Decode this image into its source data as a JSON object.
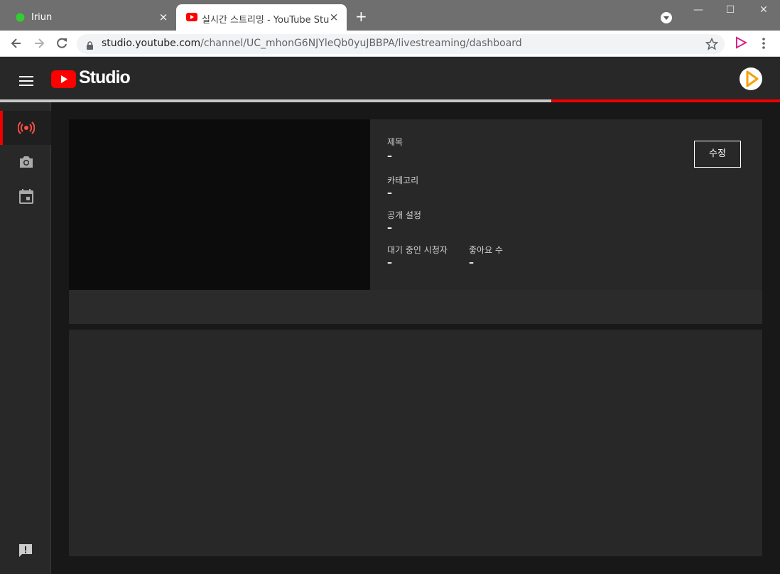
{
  "browser": {
    "tabs": [
      {
        "title": "Iriun",
        "close": "×"
      },
      {
        "title": "실시간 스트리밍 - YouTube Studio",
        "close": "×"
      }
    ],
    "new_tab": "+",
    "window_controls": {
      "minimize": "—",
      "maximize": "☐",
      "close": "✕"
    },
    "url_host": "studio.youtube.com",
    "url_path": "/channel/UC_mhonG6NJYleQb0yuJBBPA/livestreaming/dashboard"
  },
  "header": {
    "logo_text": "Studio"
  },
  "progress": {
    "value": 0.293
  },
  "stream": {
    "title_label": "제목",
    "title_value": "–",
    "category_label": "카테고리",
    "category_value": "–",
    "visibility_label": "공개 설정",
    "visibility_value": "–",
    "waiting_label": "대기 중인 시청자",
    "waiting_value": "–",
    "likes_label": "좋아요 수",
    "likes_value": "–",
    "edit_button": "수정"
  },
  "colors": {
    "accent": "#ee0000",
    "background": "#181818",
    "surface": "#282828"
  }
}
